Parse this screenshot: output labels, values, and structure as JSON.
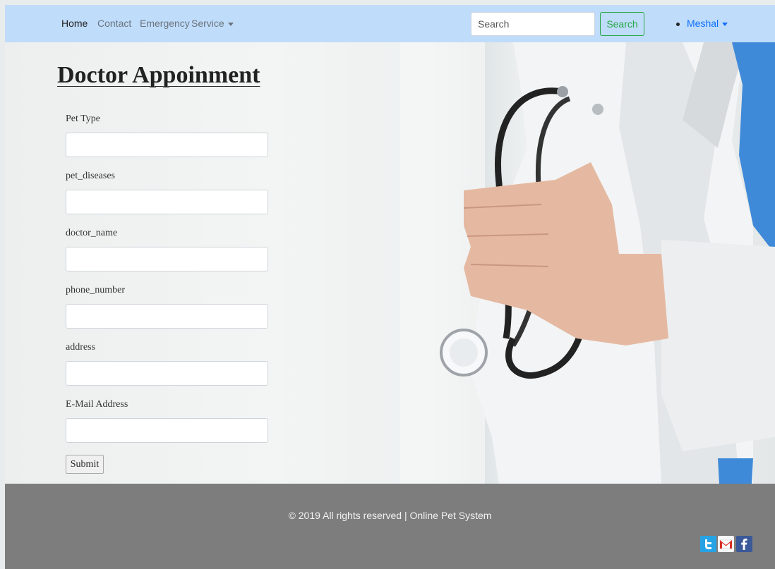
{
  "navbar": {
    "links": [
      {
        "label": "Home"
      },
      {
        "label": "Contact"
      },
      {
        "label": "Emergency"
      },
      {
        "label": "Service"
      }
    ],
    "search": {
      "placeholder": "Search",
      "button_label": "Search"
    },
    "user": {
      "name": "Meshal"
    }
  },
  "form": {
    "title": "Doctor Appoinment",
    "fields": [
      {
        "label": "Pet Type",
        "value": ""
      },
      {
        "label": "pet_diseases",
        "value": ""
      },
      {
        "label": "doctor_name",
        "value": ""
      },
      {
        "label": "phone_number",
        "value": ""
      },
      {
        "label": "address",
        "value": ""
      },
      {
        "label": "E-Mail Address",
        "value": ""
      }
    ],
    "submit_label": "Submit"
  },
  "footer": {
    "copyright": "© 2019 All rights reserved | Online Pet System",
    "social_icons": [
      "twitter-icon",
      "gmail-icon",
      "facebook-icon"
    ]
  },
  "colors": {
    "navbar_bg": "#bfdcfb",
    "footer_bg": "#7d7d7d",
    "search_button": "#28a745",
    "user_link": "#0d6efd"
  }
}
